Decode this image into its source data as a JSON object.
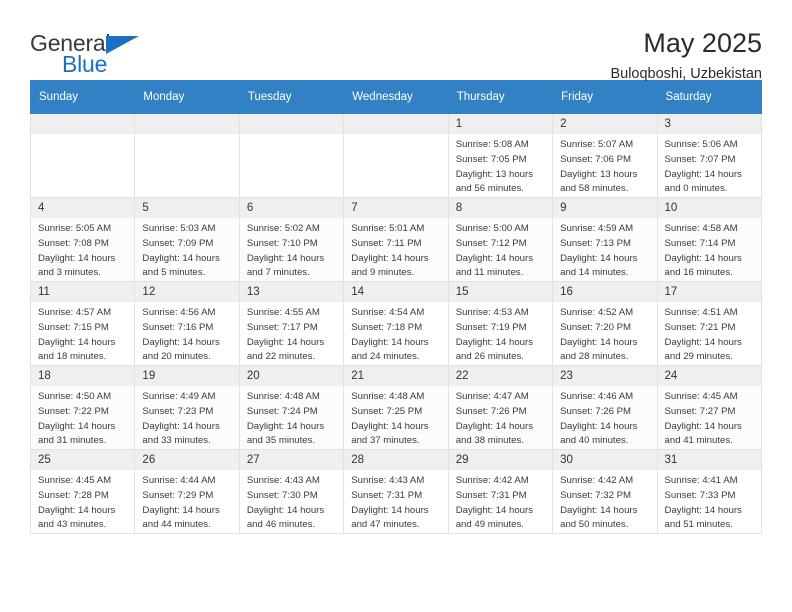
{
  "brand": {
    "name_part1": "General",
    "name_part2": "Blue",
    "accent_color": "#1a71c4"
  },
  "header": {
    "title": "May 2025",
    "subtitle": "Buloqboshi, Uzbekistan"
  },
  "calendar": {
    "header_color": "#3281c4",
    "weekdays": [
      "Sunday",
      "Monday",
      "Tuesday",
      "Wednesday",
      "Thursday",
      "Friday",
      "Saturday"
    ],
    "weeks": [
      [
        {
          "day": "",
          "empty": true,
          "sunrise": "",
          "sunset": "",
          "daylight1": "",
          "daylight2": ""
        },
        {
          "day": "",
          "empty": true,
          "sunrise": "",
          "sunset": "",
          "daylight1": "",
          "daylight2": ""
        },
        {
          "day": "",
          "empty": true,
          "sunrise": "",
          "sunset": "",
          "daylight1": "",
          "daylight2": ""
        },
        {
          "day": "",
          "empty": true,
          "sunrise": "",
          "sunset": "",
          "daylight1": "",
          "daylight2": ""
        },
        {
          "day": "1",
          "sunrise": "Sunrise: 5:08 AM",
          "sunset": "Sunset: 7:05 PM",
          "daylight1": "Daylight: 13 hours",
          "daylight2": "and 56 minutes."
        },
        {
          "day": "2",
          "sunrise": "Sunrise: 5:07 AM",
          "sunset": "Sunset: 7:06 PM",
          "daylight1": "Daylight: 13 hours",
          "daylight2": "and 58 minutes."
        },
        {
          "day": "3",
          "sunrise": "Sunrise: 5:06 AM",
          "sunset": "Sunset: 7:07 PM",
          "daylight1": "Daylight: 14 hours",
          "daylight2": "and 0 minutes."
        }
      ],
      [
        {
          "day": "4",
          "sunrise": "Sunrise: 5:05 AM",
          "sunset": "Sunset: 7:08 PM",
          "daylight1": "Daylight: 14 hours",
          "daylight2": "and 3 minutes."
        },
        {
          "day": "5",
          "sunrise": "Sunrise: 5:03 AM",
          "sunset": "Sunset: 7:09 PM",
          "daylight1": "Daylight: 14 hours",
          "daylight2": "and 5 minutes."
        },
        {
          "day": "6",
          "sunrise": "Sunrise: 5:02 AM",
          "sunset": "Sunset: 7:10 PM",
          "daylight1": "Daylight: 14 hours",
          "daylight2": "and 7 minutes."
        },
        {
          "day": "7",
          "sunrise": "Sunrise: 5:01 AM",
          "sunset": "Sunset: 7:11 PM",
          "daylight1": "Daylight: 14 hours",
          "daylight2": "and 9 minutes."
        },
        {
          "day": "8",
          "sunrise": "Sunrise: 5:00 AM",
          "sunset": "Sunset: 7:12 PM",
          "daylight1": "Daylight: 14 hours",
          "daylight2": "and 11 minutes."
        },
        {
          "day": "9",
          "sunrise": "Sunrise: 4:59 AM",
          "sunset": "Sunset: 7:13 PM",
          "daylight1": "Daylight: 14 hours",
          "daylight2": "and 14 minutes."
        },
        {
          "day": "10",
          "sunrise": "Sunrise: 4:58 AM",
          "sunset": "Sunset: 7:14 PM",
          "daylight1": "Daylight: 14 hours",
          "daylight2": "and 16 minutes."
        }
      ],
      [
        {
          "day": "11",
          "sunrise": "Sunrise: 4:57 AM",
          "sunset": "Sunset: 7:15 PM",
          "daylight1": "Daylight: 14 hours",
          "daylight2": "and 18 minutes."
        },
        {
          "day": "12",
          "sunrise": "Sunrise: 4:56 AM",
          "sunset": "Sunset: 7:16 PM",
          "daylight1": "Daylight: 14 hours",
          "daylight2": "and 20 minutes."
        },
        {
          "day": "13",
          "sunrise": "Sunrise: 4:55 AM",
          "sunset": "Sunset: 7:17 PM",
          "daylight1": "Daylight: 14 hours",
          "daylight2": "and 22 minutes."
        },
        {
          "day": "14",
          "sunrise": "Sunrise: 4:54 AM",
          "sunset": "Sunset: 7:18 PM",
          "daylight1": "Daylight: 14 hours",
          "daylight2": "and 24 minutes."
        },
        {
          "day": "15",
          "sunrise": "Sunrise: 4:53 AM",
          "sunset": "Sunset: 7:19 PM",
          "daylight1": "Daylight: 14 hours",
          "daylight2": "and 26 minutes."
        },
        {
          "day": "16",
          "sunrise": "Sunrise: 4:52 AM",
          "sunset": "Sunset: 7:20 PM",
          "daylight1": "Daylight: 14 hours",
          "daylight2": "and 28 minutes."
        },
        {
          "day": "17",
          "sunrise": "Sunrise: 4:51 AM",
          "sunset": "Sunset: 7:21 PM",
          "daylight1": "Daylight: 14 hours",
          "daylight2": "and 29 minutes."
        }
      ],
      [
        {
          "day": "18",
          "sunrise": "Sunrise: 4:50 AM",
          "sunset": "Sunset: 7:22 PM",
          "daylight1": "Daylight: 14 hours",
          "daylight2": "and 31 minutes."
        },
        {
          "day": "19",
          "sunrise": "Sunrise: 4:49 AM",
          "sunset": "Sunset: 7:23 PM",
          "daylight1": "Daylight: 14 hours",
          "daylight2": "and 33 minutes."
        },
        {
          "day": "20",
          "sunrise": "Sunrise: 4:48 AM",
          "sunset": "Sunset: 7:24 PM",
          "daylight1": "Daylight: 14 hours",
          "daylight2": "and 35 minutes."
        },
        {
          "day": "21",
          "sunrise": "Sunrise: 4:48 AM",
          "sunset": "Sunset: 7:25 PM",
          "daylight1": "Daylight: 14 hours",
          "daylight2": "and 37 minutes."
        },
        {
          "day": "22",
          "sunrise": "Sunrise: 4:47 AM",
          "sunset": "Sunset: 7:26 PM",
          "daylight1": "Daylight: 14 hours",
          "daylight2": "and 38 minutes."
        },
        {
          "day": "23",
          "sunrise": "Sunrise: 4:46 AM",
          "sunset": "Sunset: 7:26 PM",
          "daylight1": "Daylight: 14 hours",
          "daylight2": "and 40 minutes."
        },
        {
          "day": "24",
          "sunrise": "Sunrise: 4:45 AM",
          "sunset": "Sunset: 7:27 PM",
          "daylight1": "Daylight: 14 hours",
          "daylight2": "and 41 minutes."
        }
      ],
      [
        {
          "day": "25",
          "sunrise": "Sunrise: 4:45 AM",
          "sunset": "Sunset: 7:28 PM",
          "daylight1": "Daylight: 14 hours",
          "daylight2": "and 43 minutes."
        },
        {
          "day": "26",
          "sunrise": "Sunrise: 4:44 AM",
          "sunset": "Sunset: 7:29 PM",
          "daylight1": "Daylight: 14 hours",
          "daylight2": "and 44 minutes."
        },
        {
          "day": "27",
          "sunrise": "Sunrise: 4:43 AM",
          "sunset": "Sunset: 7:30 PM",
          "daylight1": "Daylight: 14 hours",
          "daylight2": "and 46 minutes."
        },
        {
          "day": "28",
          "sunrise": "Sunrise: 4:43 AM",
          "sunset": "Sunset: 7:31 PM",
          "daylight1": "Daylight: 14 hours",
          "daylight2": "and 47 minutes."
        },
        {
          "day": "29",
          "sunrise": "Sunrise: 4:42 AM",
          "sunset": "Sunset: 7:31 PM",
          "daylight1": "Daylight: 14 hours",
          "daylight2": "and 49 minutes."
        },
        {
          "day": "30",
          "sunrise": "Sunrise: 4:42 AM",
          "sunset": "Sunset: 7:32 PM",
          "daylight1": "Daylight: 14 hours",
          "daylight2": "and 50 minutes."
        },
        {
          "day": "31",
          "sunrise": "Sunrise: 4:41 AM",
          "sunset": "Sunset: 7:33 PM",
          "daylight1": "Daylight: 14 hours",
          "daylight2": "and 51 minutes."
        }
      ]
    ]
  }
}
